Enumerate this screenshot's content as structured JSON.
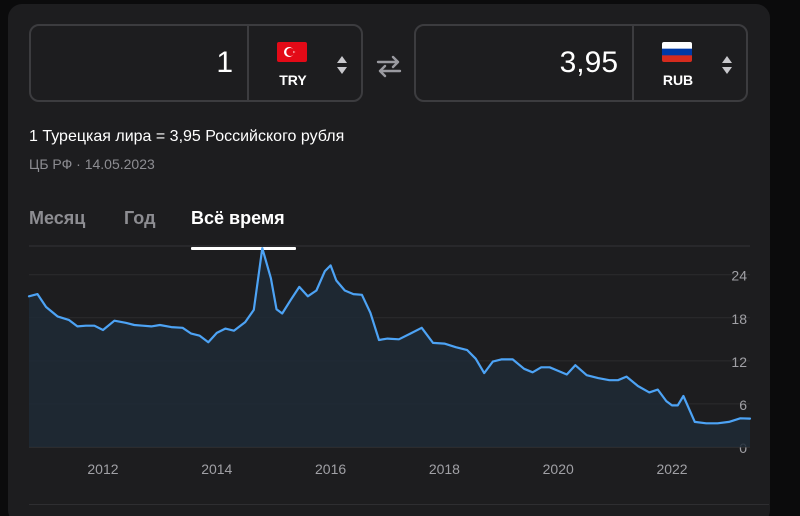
{
  "converter": {
    "from": {
      "amount": "1",
      "code": "TRY",
      "flag": "turkey-flag"
    },
    "to": {
      "amount": "3,95",
      "code": "RUB",
      "flag": "russia-flag"
    },
    "swap_icon": "swap-arrows-icon"
  },
  "rate_text": "1 Турецкая лира = 3,95 Российского рубля",
  "source_text": "ЦБ РФ · 14.05.2023",
  "tabs": [
    {
      "label": "Месяц",
      "active": false
    },
    {
      "label": "Год",
      "active": false
    },
    {
      "label": "Всё время",
      "active": true
    }
  ],
  "colors": {
    "line": "#4da3f5",
    "active_tab": "#ffffff",
    "inactive_tab": "#8d8d92",
    "panel": "#1d1d1f"
  },
  "chart_data": {
    "type": "area",
    "x_ticks": [
      "2012",
      "2014",
      "2016",
      "2018",
      "2020",
      "2022"
    ],
    "y_ticks": [
      "0",
      "6",
      "12",
      "18",
      "24"
    ],
    "xlim": [
      2010.7,
      2023.37
    ],
    "ylim": [
      0,
      28
    ],
    "grid": true,
    "series": [
      {
        "x": [
          2010.7,
          2010.85,
          2011.0,
          2011.2,
          2011.4,
          2011.55,
          2011.7,
          2011.85,
          2012.0,
          2012.2,
          2012.4,
          2012.55,
          2012.7,
          2012.85,
          2013.0,
          2013.2,
          2013.4,
          2013.55,
          2013.7,
          2013.85,
          2014.0,
          2014.15,
          2014.3,
          2014.5,
          2014.65,
          2014.8,
          2014.95,
          2015.05,
          2015.15,
          2015.3,
          2015.45,
          2015.6,
          2015.75,
          2015.9,
          2016.0,
          2016.1,
          2016.25,
          2016.4,
          2016.55,
          2016.7,
          2016.85,
          2017.0,
          2017.2,
          2017.4,
          2017.6,
          2017.8,
          2018.0,
          2018.2,
          2018.4,
          2018.55,
          2018.7,
          2018.85,
          2019.0,
          2019.2,
          2019.4,
          2019.55,
          2019.7,
          2019.85,
          2020.0,
          2020.15,
          2020.3,
          2020.5,
          2020.7,
          2020.9,
          2021.05,
          2021.2,
          2021.4,
          2021.6,
          2021.75,
          2021.9,
          2022.0,
          2022.1,
          2022.2,
          2022.4,
          2022.6,
          2022.8,
          2023.0,
          2023.2,
          2023.37
        ],
        "y": [
          21,
          21.3,
          19.5,
          18.2,
          17.7,
          16.8,
          16.9,
          16.9,
          16.3,
          17.6,
          17.3,
          17,
          16.9,
          16.8,
          17,
          16.7,
          16.6,
          15.8,
          15.5,
          14.6,
          15.9,
          16.5,
          16.2,
          17.4,
          19.1,
          27.7,
          23.5,
          19.2,
          18.6,
          20.5,
          22.3,
          21,
          21.8,
          24.5,
          25.3,
          23.2,
          21.8,
          21.3,
          21.2,
          18.7,
          14.9,
          15.1,
          15,
          15.8,
          16.6,
          14.5,
          14.4,
          13.9,
          13.5,
          12.3,
          10.3,
          11.9,
          12.2,
          12.2,
          10.9,
          10.4,
          11.1,
          11.1,
          10.6,
          10.1,
          11.4,
          10,
          9.6,
          9.3,
          9.3,
          9.8,
          8.5,
          7.6,
          8,
          6.4,
          5.8,
          5.8,
          7.1,
          3.5,
          3.3,
          3.3,
          3.5,
          4,
          3.95
        ]
      }
    ]
  }
}
